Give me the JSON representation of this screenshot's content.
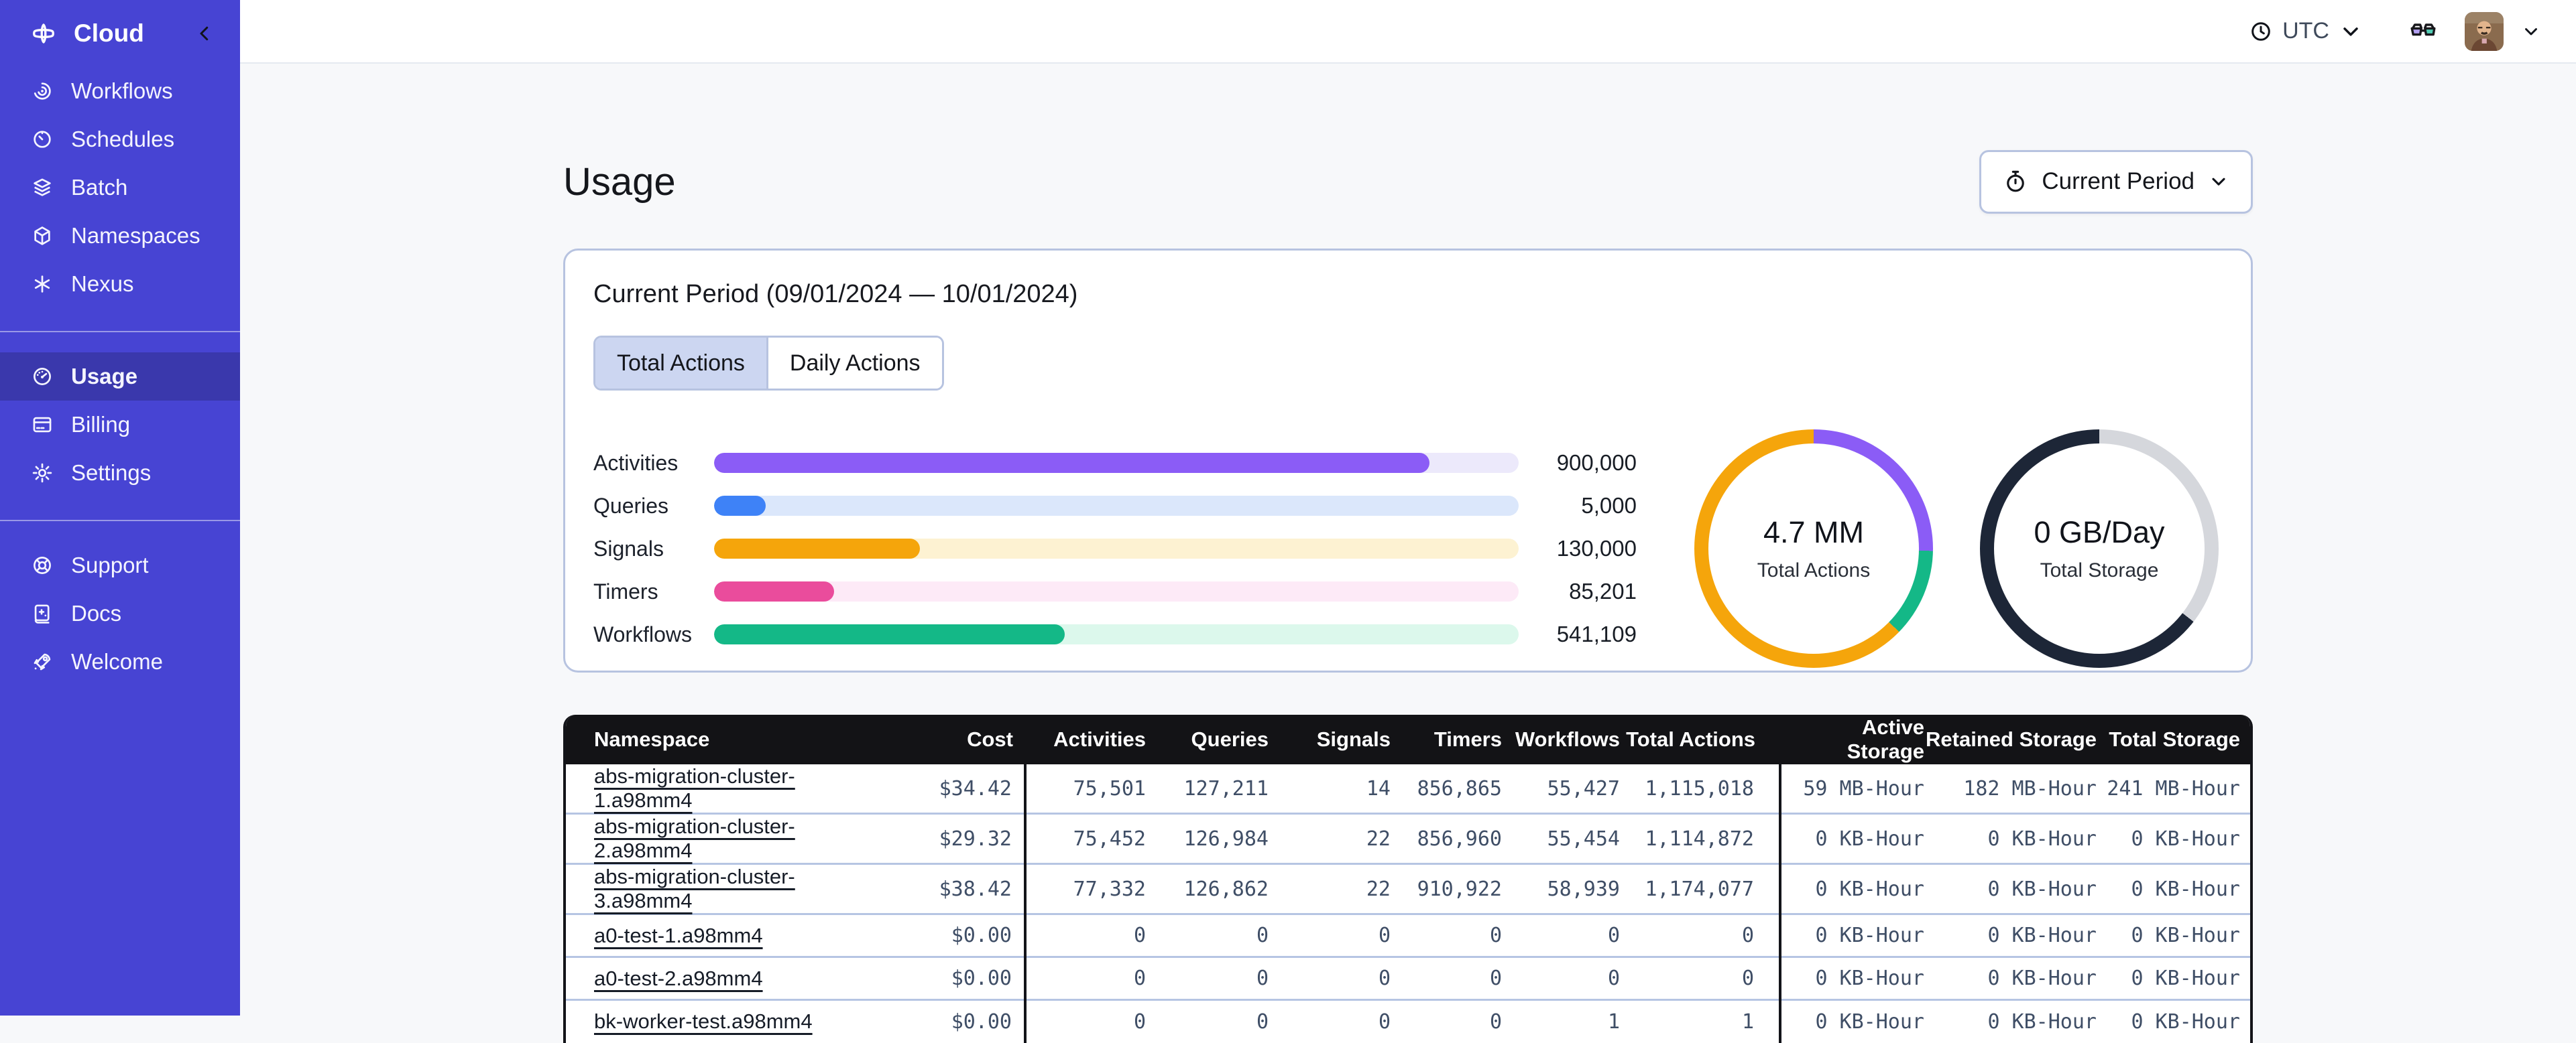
{
  "sidebar": {
    "brand": {
      "label": "Cloud"
    },
    "nav_main": [
      {
        "label": "Workflows"
      },
      {
        "label": "Schedules"
      },
      {
        "label": "Batch"
      },
      {
        "label": "Namespaces"
      },
      {
        "label": "Nexus"
      }
    ],
    "nav_account": [
      {
        "label": "Usage",
        "active": true
      },
      {
        "label": "Billing",
        "active": false
      },
      {
        "label": "Settings",
        "active": false
      }
    ],
    "nav_help": [
      {
        "label": "Support"
      },
      {
        "label": "Docs"
      },
      {
        "label": "Welcome"
      }
    ]
  },
  "topbar": {
    "timezone": "UTC"
  },
  "page": {
    "title": "Usage"
  },
  "period_selector": {
    "label": "Current Period"
  },
  "usage_card": {
    "title": "Current Period (09/01/2024 — 10/01/2024)",
    "tabs": [
      {
        "label": "Total Actions",
        "selected": true
      },
      {
        "label": "Daily Actions",
        "selected": false
      }
    ]
  },
  "chart_data": [
    {
      "type": "bar",
      "orientation": "horizontal",
      "categories": [
        "Activities",
        "Queries",
        "Signals",
        "Timers",
        "Workflows"
      ],
      "values": [
        900000,
        5000,
        130000,
        85201,
        541109
      ],
      "display_values": [
        "900,000",
        "5,000",
        "130,000",
        "85,201",
        "541,109"
      ],
      "fill_pct": [
        88.9,
        6.4,
        25.6,
        14.9,
        43.6
      ],
      "colors": [
        "#8b5cf6",
        "#3e82f7",
        "#f5a50b",
        "#ea4c9c",
        "#14b887"
      ],
      "track_colors": [
        "#ece9fb",
        "#dbe7fb",
        "#fdf2d2",
        "#fdeaf7",
        "#dcf8ec"
      ],
      "grid": false,
      "legend": false
    },
    {
      "type": "pie",
      "subtype": "donut",
      "center_value": "4.7 MM",
      "center_label": "Total Actions",
      "segments": [
        {
          "color": "#8b5cf6",
          "pct": 25.3
        },
        {
          "color": "#14b887",
          "pct": 12.0
        },
        {
          "color": "#f5a50b",
          "pct": 62.7
        }
      ]
    },
    {
      "type": "pie",
      "subtype": "donut",
      "center_value": "0 GB/Day",
      "center_label": "Total Storage",
      "segments": [
        {
          "color": "#d5d7dc",
          "pct": 35.5
        },
        {
          "color": "#1d2637",
          "pct": 64.5
        }
      ]
    }
  ],
  "table": {
    "headers": [
      "Namespace",
      "Cost",
      "Activities",
      "Queries",
      "Signals",
      "Timers",
      "Workflows",
      "Total Actions",
      "Active Storage",
      "Retained Storage",
      "Total Storage"
    ],
    "rows": [
      [
        "abs-migration-cluster-1.a98mm4",
        "$34.42",
        "75,501",
        "127,211",
        "14",
        "856,865",
        "55,427",
        "1,115,018",
        "59 MB-Hour",
        "182 MB-Hour",
        "241 MB-Hour"
      ],
      [
        "abs-migration-cluster-2.a98mm4",
        "$29.32",
        "75,452",
        "126,984",
        "22",
        "856,960",
        "55,454",
        "1,114,872",
        "0 KB-Hour",
        "0 KB-Hour",
        "0 KB-Hour"
      ],
      [
        "abs-migration-cluster-3.a98mm4",
        "$38.42",
        "77,332",
        "126,862",
        "22",
        "910,922",
        "58,939",
        "1,174,077",
        "0 KB-Hour",
        "0 KB-Hour",
        "0 KB-Hour"
      ],
      [
        "a0-test-1.a98mm4",
        "$0.00",
        "0",
        "0",
        "0",
        "0",
        "0",
        "0",
        "0 KB-Hour",
        "0 KB-Hour",
        "0 KB-Hour"
      ],
      [
        "a0-test-2.a98mm4",
        "$0.00",
        "0",
        "0",
        "0",
        "0",
        "0",
        "0",
        "0 KB-Hour",
        "0 KB-Hour",
        "0 KB-Hour"
      ],
      [
        "bk-worker-test.a98mm4",
        "$0.00",
        "0",
        "0",
        "0",
        "0",
        "1",
        "1",
        "0 KB-Hour",
        "0 KB-Hour",
        "0 KB-Hour"
      ]
    ]
  }
}
